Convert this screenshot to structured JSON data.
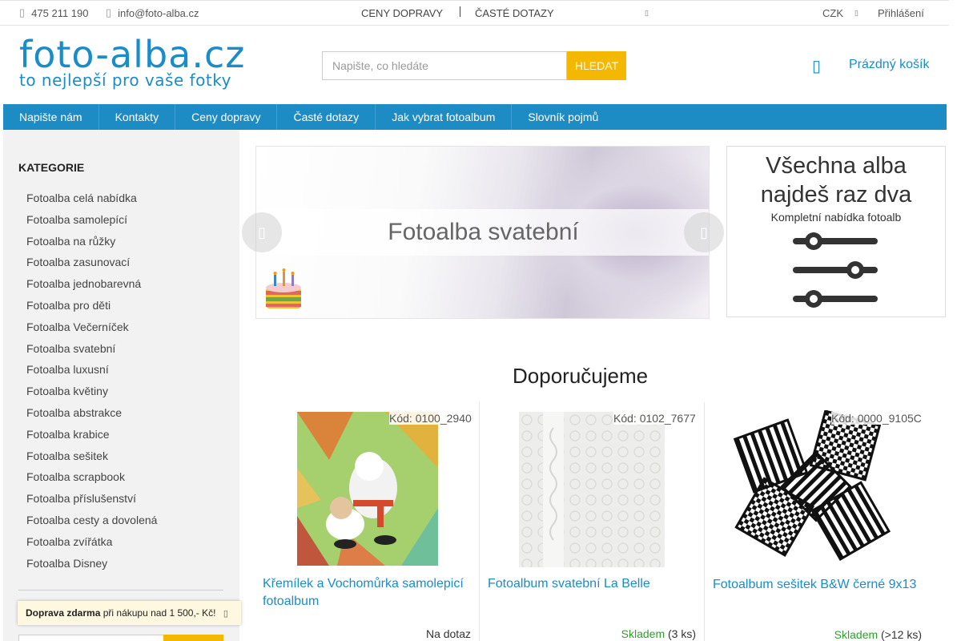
{
  "topbar": {
    "phone": "475 211 190",
    "email": "info@foto-alba.cz",
    "links": [
      "CENY DOPRAVY",
      "ČASTÉ DOTAZY"
    ],
    "currency": "CZK",
    "login": "Přihlášení"
  },
  "header": {
    "logo_main": "foto-alba.cz",
    "logo_tagline": "to nejlepší pro vaše fotky",
    "search_placeholder": "Napište, co hledáte",
    "search_button": "HLEDAT",
    "cart_label": "Prázdný košík"
  },
  "nav": [
    "Napište nám",
    "Kontakty",
    "Ceny dopravy",
    "Časté dotazy",
    "Jak vybrat fotoalbum",
    "Slovník pojmů"
  ],
  "sidebar": {
    "heading": "KATEGORIE",
    "items": [
      "Fotoalba celá nabídka",
      "Fotoalba samolepící",
      "Fotoalba na růžky",
      "Fotoalba zasunovací",
      "Fotoalba jednobarevná",
      "Fotoalba pro děti",
      "Fotoalba Večerníček",
      "Fotoalba svatební",
      "Fotoalba luxusní",
      "Fotoalba květiny",
      "Fotoalba abstrakce",
      "Fotoalba krabice",
      "Fotoalba sešitek",
      "Fotoalba scrapbook",
      "Fotoalba příslušenství",
      "Fotoalba cesty a dovolená",
      "Fotoalba zvířátka",
      "Fotoalba Disney"
    ]
  },
  "shipping_notice": {
    "bold": "Doprava zdarma",
    "rest": "při nákupu nad 1 500,- Kč!"
  },
  "banner": {
    "title": "Fotoalba svatební"
  },
  "side_banner": {
    "line1": "Všechna alba",
    "line2": "najdeš raz dva",
    "line3": "Kompletní nabídka fotoalb"
  },
  "recommended": {
    "title": "Doporučujeme",
    "products": [
      {
        "code": "Kód: 0100_2940",
        "name": "Křemílek a Vochomůrka samolepicí fotoalbum",
        "stock_status": "Na dotaz",
        "stock_qty": ""
      },
      {
        "code": "Kód: 0102_7677",
        "name": "Fotoalbum svatební La Belle",
        "stock_status": "Skladem",
        "stock_qty": "(3 ks)"
      },
      {
        "code": "Kód: 0000_9105C",
        "name": "Fotoalbum sešitek B&W černé 9x13",
        "stock_status": "Skladem",
        "stock_qty": "(>12 ks)"
      }
    ]
  },
  "colors": {
    "brand_blue": "#1e8cc4",
    "accent_yellow": "#f5b800",
    "stock_green": "#2e9e2e"
  }
}
